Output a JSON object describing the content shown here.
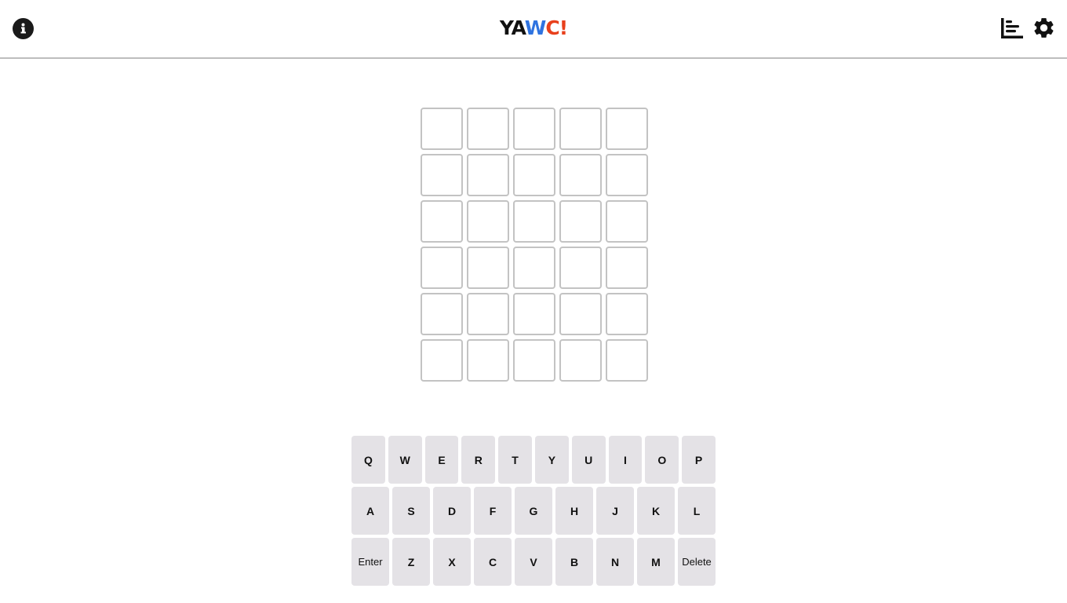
{
  "header": {
    "title_part1": "YA",
    "title_part2": "W",
    "title_part3": "C!",
    "icons": [
      "info-icon",
      "stats-icon",
      "settings-icon"
    ],
    "colors": {
      "title_dark": "#111111",
      "title_blue": "#2f73e0",
      "title_red": "#e8401c"
    }
  },
  "grid": {
    "rows": [
      [
        "",
        "",
        "",
        "",
        ""
      ],
      [
        "",
        "",
        "",
        "",
        ""
      ],
      [
        "",
        "",
        "",
        "",
        ""
      ],
      [
        "",
        "",
        "",
        "",
        ""
      ],
      [
        "",
        "",
        "",
        "",
        ""
      ],
      [
        "",
        "",
        "",
        "",
        ""
      ]
    ]
  },
  "keyboard": {
    "rows": [
      [
        "Q",
        "W",
        "E",
        "R",
        "T",
        "Y",
        "U",
        "I",
        "O",
        "P"
      ],
      [
        "A",
        "S",
        "D",
        "F",
        "G",
        "H",
        "J",
        "K",
        "L"
      ],
      [
        "Enter",
        "Z",
        "X",
        "C",
        "V",
        "B",
        "N",
        "M",
        "Delete"
      ]
    ]
  }
}
